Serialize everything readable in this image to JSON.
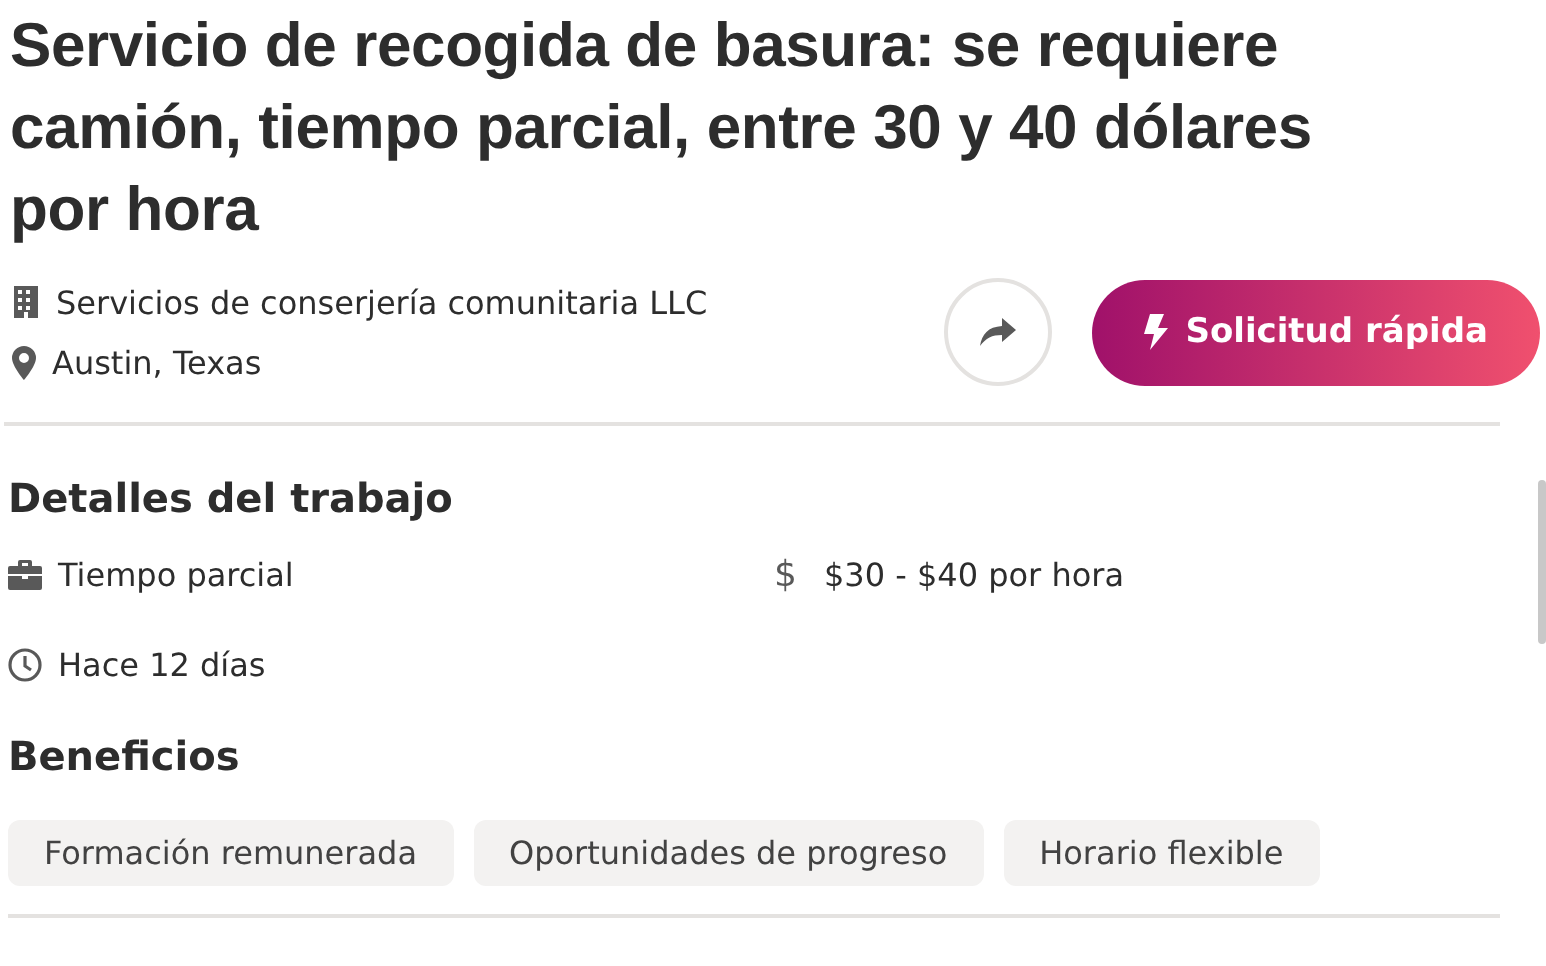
{
  "title": "Servicio de recogida de basura: se requiere camión, tiempo parcial, entre 30 y 40 dólares por hora",
  "company": "Servicios de conserjería comunitaria LLC",
  "location": "Austin, Texas",
  "actions": [
    {
      "kind": "share"
    },
    {
      "kind": "apply",
      "label": "Solicitud rápida"
    }
  ],
  "details": {
    "heading": "Detalles del trabajo",
    "items": [
      {
        "kind": "job_type",
        "text": "Tiempo parcial"
      },
      {
        "kind": "pay",
        "icon": "$",
        "text": "$30 - $40 por hora"
      },
      {
        "kind": "posted",
        "text": "Hace 12 días"
      }
    ]
  },
  "benefits": {
    "heading": "Beneficios",
    "tags": [
      "Formación remunerada",
      "Oportunidades de progreso",
      "Horario flexible"
    ]
  }
}
